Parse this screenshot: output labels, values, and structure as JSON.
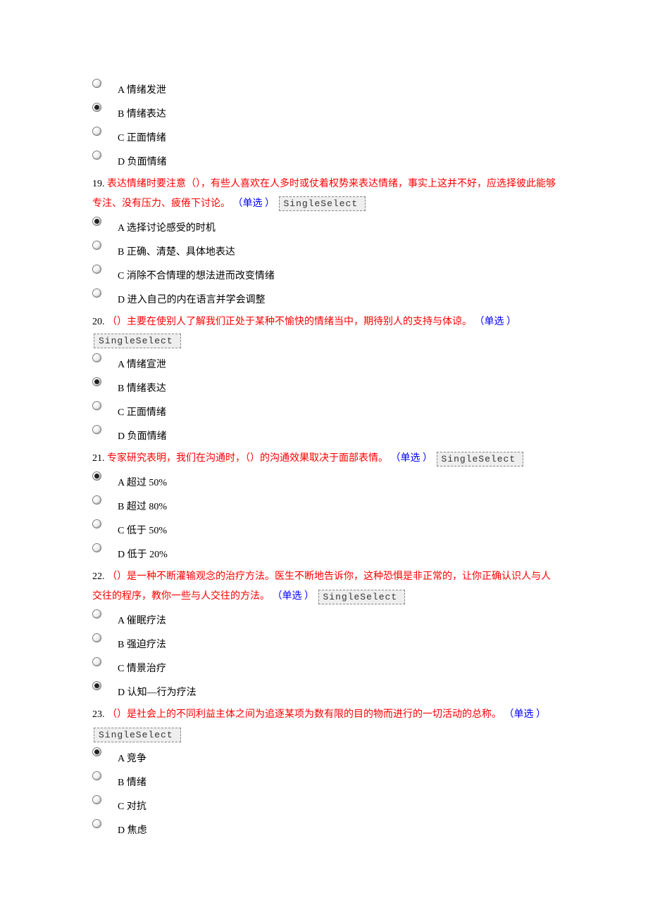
{
  "selectBoxLabel": "SingleSelect",
  "q18": {
    "opts": {
      "A": "A 情绪发泄",
      "B": "B 情绪表达",
      "C": "C 正面情绪",
      "D": "D 负面情绪"
    }
  },
  "q19": {
    "num": "19.",
    "text_a": "表达情绪时要注意（），有些人喜欢在人多时或仗着权势来表达情绪，事实上这并不好，应选择彼此能够专注、没有压力、疲倦下讨论。",
    "type": "（单选 ）",
    "opts": {
      "A": "A 选择讨论感受的时机",
      "B": "B 正确、清楚、具体地表达",
      "C": "C 消除不合情理的想法进而改变情绪",
      "D": "D 进入自己的内在语言并学会调整"
    }
  },
  "q20": {
    "num": "20.",
    "text_a": "（）主要在使别人了解我们正处于某种不愉快的情绪当中，期待别人的支持与体谅。",
    "type": "（单选 ）",
    "opts": {
      "A": "A 情绪宣泄",
      "B": "B 情绪表达",
      "C": "C 正面情绪",
      "D": "D 负面情绪"
    }
  },
  "q21": {
    "num": "21.",
    "text_a": "专家研究表明，我们在沟通时，（）的沟通效果取决于面部表情。",
    "type": "（单选 ）",
    "opts": {
      "A": "A 超过 50%",
      "B": "B 超过 80%",
      "C": "C 低于 50%",
      "D": "D 低于 20%"
    }
  },
  "q22": {
    "num": "22.",
    "text_a": "（）是一种不断灌输观念的治疗方法。医生不断地告诉你，这种恐惧是非正常的，让你正确认识人与人交往的程序，教你一些与人交往的方法。",
    "type": "（单选 ）",
    "opts": {
      "A": "A 催眠疗法",
      "B": "B 强迫疗法",
      "C": "C 情景治疗",
      "D": "D 认知—行为疗法"
    }
  },
  "q23": {
    "num": "23.",
    "text_a": "（）是社会上的不同利益主体之间为追逐某项为数有限的目的物而进行的一切活动的总称。",
    "type": "（单选 ）",
    "opts": {
      "A": "A 竞争",
      "B": "B 情绪",
      "C": "C 对抗",
      "D": "D 焦虑"
    }
  }
}
